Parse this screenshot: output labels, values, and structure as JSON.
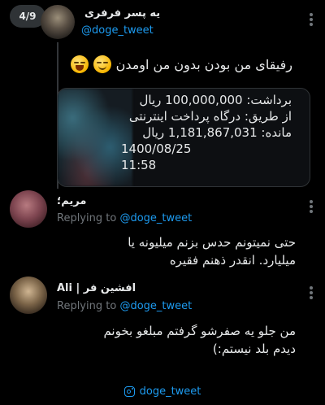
{
  "thread": {
    "counter": "4/9"
  },
  "main_tweet": {
    "name": "یه پسر فرفری",
    "handle": "@doge_tweet",
    "text": "رفیقای من بودن بدون من اومدن",
    "emojis": [
      "laughing-tears-emoji",
      "pensive-face-emoji"
    ],
    "sms": {
      "line1": "برداشت: 100,000,000 ریال",
      "line2": "از طریق: درگاه پرداخت اینترنتی",
      "line3": "مانده: 1,181,867,031 ریال",
      "date": "1400/08/25",
      "time": "11:58"
    }
  },
  "replies": [
    {
      "name": "مریم؛",
      "replying_prefix": "Replying to",
      "replying_handle": "@doge_tweet",
      "text_line1": "حتی نمیتونم حدس بزنم میلیونه یا",
      "text_line2": "میلیارد. انقدر ذهنم فقیره"
    },
    {
      "name": "افشین فر | Ali",
      "replying_prefix": "Replying to",
      "replying_handle": "@doge_tweet",
      "text_line1": "من جلو یه صفرشو گرفتم مبلغو بخونم",
      "text_line2": "دیدم بلد نیستم:)"
    }
  ],
  "footer": {
    "icon": "instagram-icon",
    "handle": "doge_tweet"
  },
  "colors": {
    "background": "#000000",
    "link": "#1d9bf0",
    "text": "#e7e9ea",
    "muted": "#71767b"
  }
}
